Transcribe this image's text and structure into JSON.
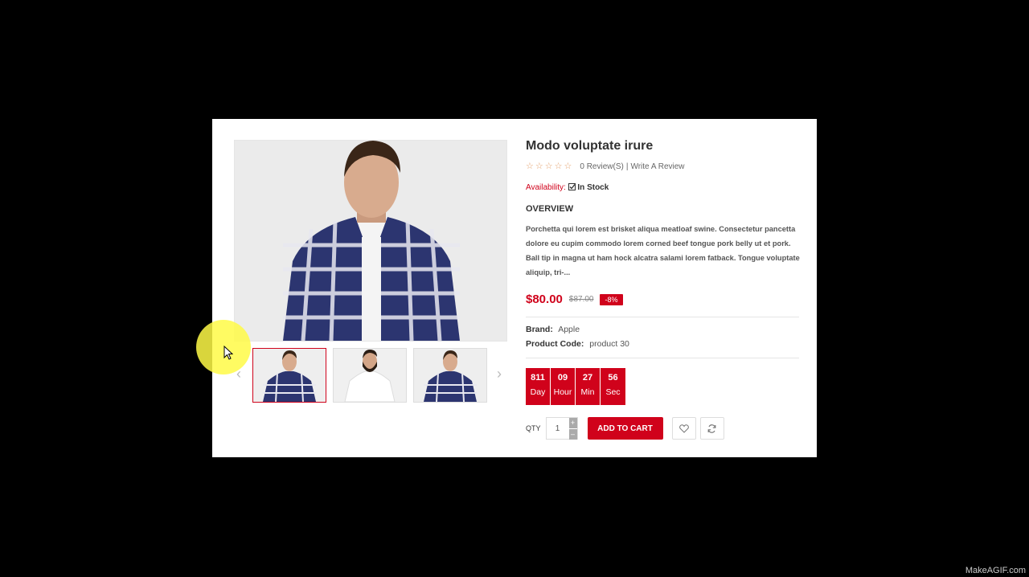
{
  "product": {
    "title": "Modo voluptate irure",
    "reviews": "0 Review(S)",
    "review_sep": "|",
    "write_review": "Write A Review",
    "availability_label": "Availability:",
    "availability_value": "In Stock",
    "overview_heading": "OVERVIEW",
    "overview_text": "Porchetta qui lorem est brisket aliqua meatloaf swine. Consectetur pancetta dolore eu cupim commodo lorem corned beef tongue pork belly ut et pork. Ball tip in magna ut ham hock alcatra salami lorem fatback. Tongue voluptate aliquip, tri-...",
    "price": "$80.00",
    "old_price": "$87.00",
    "discount": "-8%",
    "brand_label": "Brand:",
    "brand_value": "Apple",
    "code_label": "Product Code:",
    "code_value": "product 30"
  },
  "countdown": [
    {
      "num": "811",
      "label": "Day"
    },
    {
      "num": "09",
      "label": "Hour"
    },
    {
      "num": "27",
      "label": "Min"
    },
    {
      "num": "56",
      "label": "Sec"
    }
  ],
  "cart": {
    "qty_label": "QTY",
    "qty_value": "1",
    "plus": "+",
    "minus": "–",
    "add_label": "ADD TO CART"
  },
  "icons": {
    "star": "star-outline-icon",
    "check": "check-square-icon",
    "wishlist": "heart-icon",
    "compare": "refresh-icon",
    "prev": "chevron-left-icon",
    "next": "chevron-right-icon"
  },
  "colors": {
    "accent": "#d0021b",
    "star": "#e4a06b",
    "background": "#000000",
    "highlight": "#fffa46"
  },
  "watermark": "MakeAGIF.com"
}
